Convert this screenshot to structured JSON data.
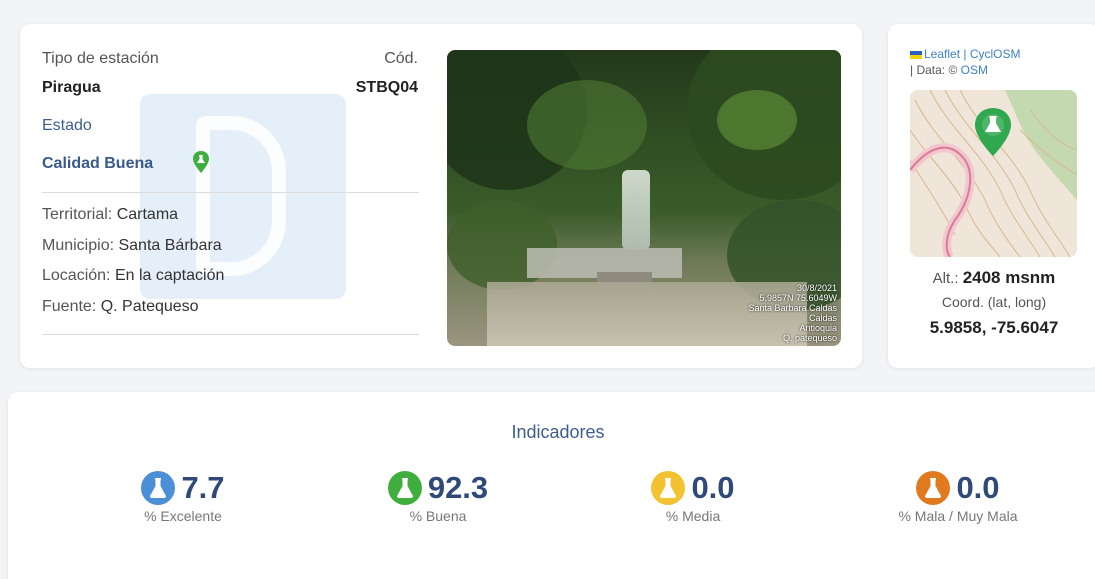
{
  "station": {
    "type_label": "Tipo de estación",
    "type_value": "Piragua",
    "code_label": "Cód.",
    "code_value": "STBQ04",
    "status_label": "Estado",
    "status_value": "Calidad Buena",
    "territorial_label": "Territorial:",
    "territorial_value": "Cartama",
    "municipio_label": "Municipio:",
    "municipio_value": "Santa Bárbara",
    "locacion_label": "Locación:",
    "locacion_value": "En la captación",
    "fuente_label": "Fuente:",
    "fuente_value": "Q. Patequeso"
  },
  "photo": {
    "stamp_lines": [
      "30/8/2021",
      "5.9857N 75.6049W",
      "Santa Barbara Caldas",
      "Caldas",
      "Antioquia",
      "Q. patequeso"
    ]
  },
  "map": {
    "attr_leaflet": "Leaflet",
    "attr_sep": " | ",
    "attr_cyclosm": "CyclOSM",
    "attr_data": "| Data: © ",
    "attr_osm": "OSM",
    "alt_label": "Alt.:",
    "alt_value": "2408 msnm",
    "coord_label": "Coord. (lat, long)",
    "coord_value": "5.9858, -75.6047"
  },
  "indicators": {
    "title": "Indicadores",
    "items": [
      {
        "value": "7.7",
        "label": "% Excelente",
        "color": "#4a8fd8"
      },
      {
        "value": "92.3",
        "label": "% Buena",
        "color": "#3fae3f"
      },
      {
        "value": "0.0",
        "label": "% Media",
        "color": "#f2c230"
      },
      {
        "value": "0.0",
        "label": "% Mala / Muy Mala",
        "color": "#e07a1f"
      }
    ]
  },
  "colors": {
    "accent": "#3d5d8f",
    "good": "#3fae3f",
    "map_marker": "#2fa84f"
  }
}
